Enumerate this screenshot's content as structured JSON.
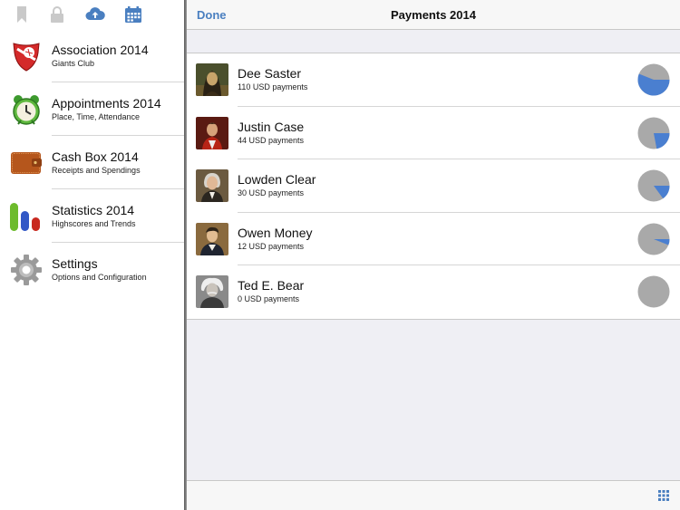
{
  "sidebar": {
    "toolbar": {
      "icons": [
        "bookmark-icon",
        "lock-icon",
        "cloud-upload-icon",
        "calendar-icon"
      ]
    },
    "items": [
      {
        "title": "Association 2014",
        "subtitle": "Giants Club",
        "icon": "club-logo-icon"
      },
      {
        "title": "Appointments 2014",
        "subtitle": "Place, Time, Attendance",
        "icon": "alarm-clock-icon"
      },
      {
        "title": "Cash Box 2014",
        "subtitle": "Receipts and Spendings",
        "icon": "wallet-icon"
      },
      {
        "title": "Statistics 2014",
        "subtitle": "Highscores and Trends",
        "icon": "bar-chart-icon"
      },
      {
        "title": "Settings",
        "subtitle": "Options and Configuration",
        "icon": "gear-icon"
      }
    ]
  },
  "detail": {
    "done_label": "Done",
    "title": "Payments 2014",
    "people": [
      {
        "name": "Dee Saster",
        "payments": "110 USD payments",
        "share": 0.56
      },
      {
        "name": "Justin Case",
        "payments": "44 USD payments",
        "share": 0.22
      },
      {
        "name": "Lowden Clear",
        "payments": "30 USD payments",
        "share": 0.15
      },
      {
        "name": "Owen Money",
        "payments": "12 USD payments",
        "share": 0.06
      },
      {
        "name": "Ted E. Bear",
        "payments": "0 USD payments",
        "share": 0
      }
    ]
  },
  "colors": {
    "accent": "#4a7fc0",
    "pie_fill": "#4a7fd0",
    "pie_base": "#a9a9a9"
  }
}
